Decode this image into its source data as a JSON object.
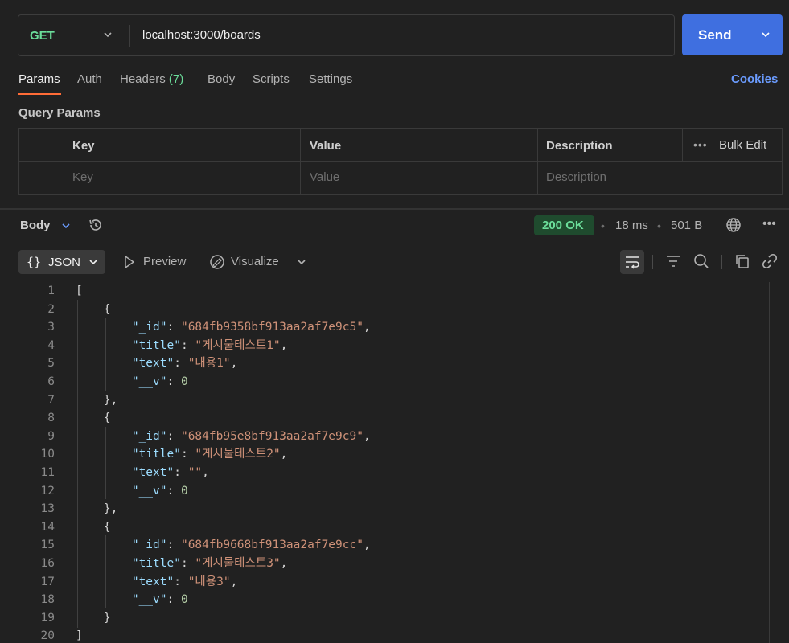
{
  "request": {
    "method": "GET",
    "url": "localhost:3000/boards",
    "send_label": "Send"
  },
  "tabs": {
    "params": "Params",
    "auth": "Auth",
    "headers": "Headers",
    "headers_count": "(7)",
    "body": "Body",
    "scripts": "Scripts",
    "settings": "Settings",
    "cookies": "Cookies"
  },
  "query_params": {
    "title": "Query Params",
    "columns": {
      "key": "Key",
      "value": "Value",
      "description": "Description"
    },
    "bulk_edit": "Bulk Edit",
    "placeholders": {
      "key": "Key",
      "value": "Value",
      "description": "Description"
    }
  },
  "response": {
    "body_label": "Body",
    "status": "200 OK",
    "time": "18 ms",
    "size": "501 B",
    "format": "JSON",
    "preview": "Preview",
    "visualize": "Visualize"
  },
  "colors": {
    "accent": "#ff6c37",
    "send": "#3f6fe0",
    "status_ok": "#6bdd9a",
    "method_get": "#6bdd9a",
    "link": "#6b9cff"
  },
  "icons": [
    "chevron-down-icon",
    "history-icon",
    "globe-icon",
    "more-icon",
    "play-icon",
    "visualize-icon",
    "wrap-icon",
    "filter-icon",
    "search-icon",
    "copy-icon",
    "link-icon"
  ],
  "code_lines": [
    {
      "n": "1",
      "text": "["
    },
    {
      "n": "2",
      "text": "    {"
    },
    {
      "n": "3",
      "text": "        \"_id\": \"684fb9358bf913aa2af7e9c5\","
    },
    {
      "n": "4",
      "text": "        \"title\": \"게시물테스트1\","
    },
    {
      "n": "5",
      "text": "        \"text\": \"내용1\","
    },
    {
      "n": "6",
      "text": "        \"__v\": 0"
    },
    {
      "n": "7",
      "text": "    },"
    },
    {
      "n": "8",
      "text": "    {"
    },
    {
      "n": "9",
      "text": "        \"_id\": \"684fb95e8bf913aa2af7e9c9\","
    },
    {
      "n": "10",
      "text": "        \"title\": \"게시물테스트2\","
    },
    {
      "n": "11",
      "text": "        \"text\": \"\","
    },
    {
      "n": "12",
      "text": "        \"__v\": 0"
    },
    {
      "n": "13",
      "text": "    },"
    },
    {
      "n": "14",
      "text": "    {"
    },
    {
      "n": "15",
      "text": "        \"_id\": \"684fb9668bf913aa2af7e9cc\","
    },
    {
      "n": "16",
      "text": "        \"title\": \"게시물테스트3\","
    },
    {
      "n": "17",
      "text": "        \"text\": \"내용3\","
    },
    {
      "n": "18",
      "text": "        \"__v\": 0"
    },
    {
      "n": "19",
      "text": "    }"
    },
    {
      "n": "20",
      "text": "]"
    }
  ]
}
